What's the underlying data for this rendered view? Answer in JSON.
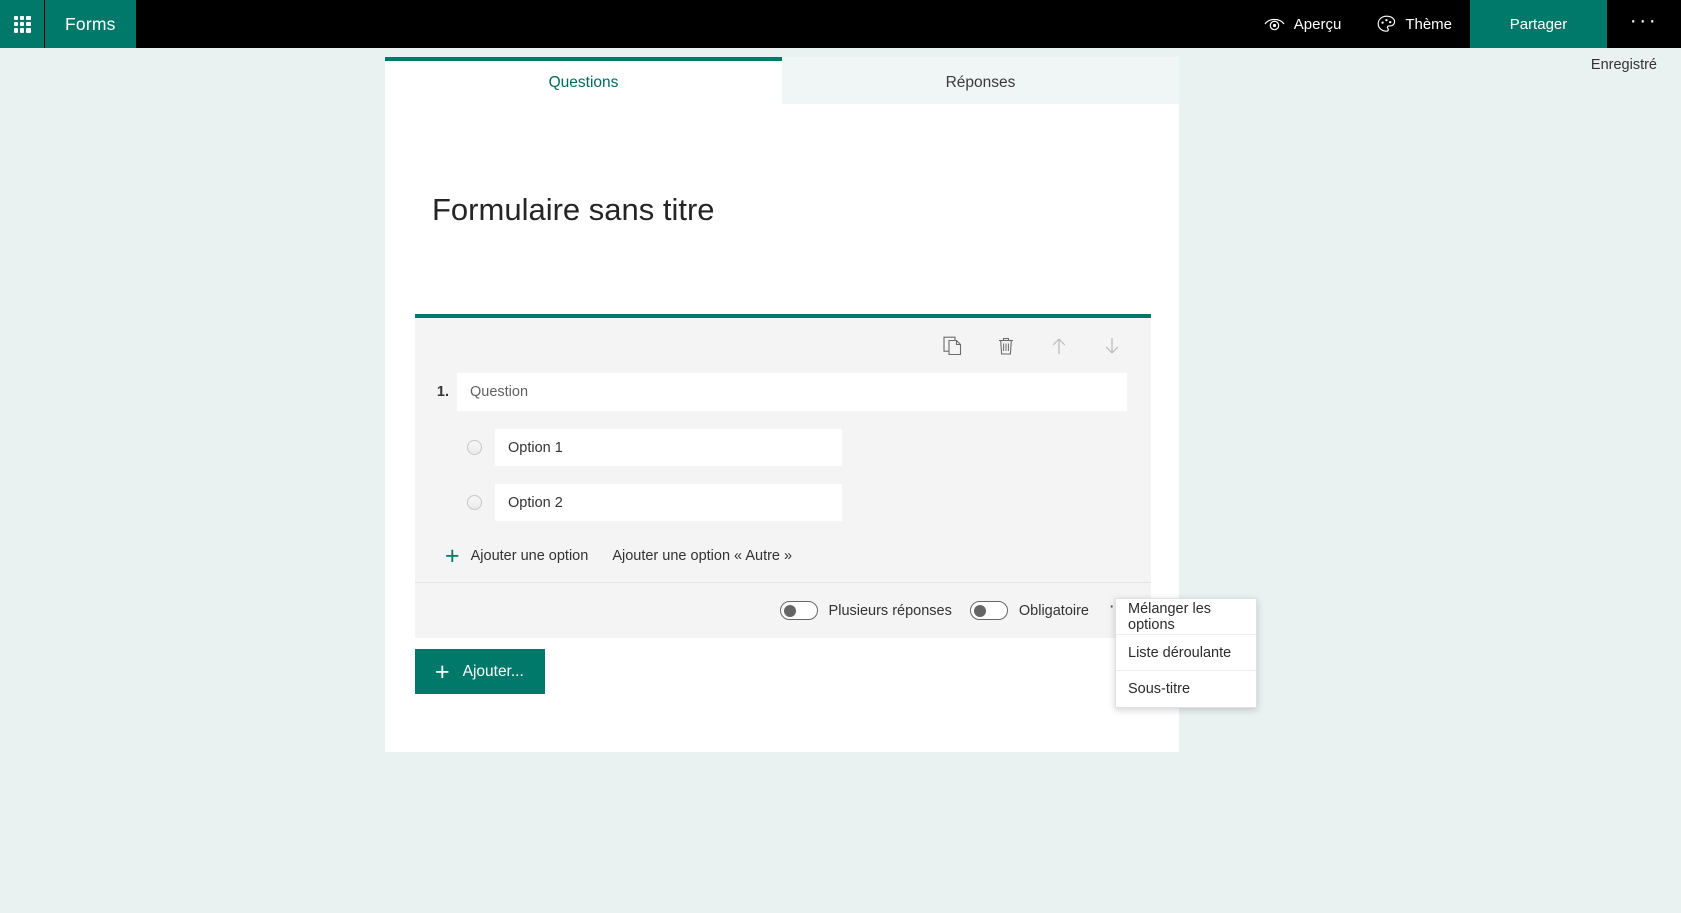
{
  "header": {
    "waffle_icon": "app-launcher-waffle-icon",
    "brand": "Forms",
    "preview": {
      "label": "Aperçu",
      "icon": "eye-preview-icon"
    },
    "theme": {
      "label": "Thème",
      "icon": "palette-theme-icon"
    },
    "share_label": "Partager",
    "more_label": "···",
    "accent_color": "#00796b",
    "bar_color": "#000000"
  },
  "status": {
    "saved_label": "Enregistré"
  },
  "tabs": [
    {
      "label": "Questions",
      "active": true
    },
    {
      "label": "Réponses",
      "active": false
    }
  ],
  "form": {
    "title": "Formulaire sans titre",
    "question": {
      "number": "1.",
      "text": "Question",
      "toolbar": [
        {
          "name": "copy-question-icon"
        },
        {
          "name": "delete-question-icon"
        },
        {
          "name": "move-up-icon"
        },
        {
          "name": "move-down-icon"
        }
      ],
      "options": [
        {
          "label": "Option 1"
        },
        {
          "label": "Option 2"
        }
      ],
      "add_option_label": "Ajouter une option",
      "add_other_option_label": "Ajouter une option « Autre »",
      "toggles": [
        {
          "label": "Plusieurs réponses",
          "on": false
        },
        {
          "label": "Obligatoire",
          "on": false
        }
      ],
      "more_label": "···"
    },
    "add_button_label": "Ajouter..."
  },
  "context_menu": {
    "items": [
      {
        "label": "Mélanger les options"
      },
      {
        "label": "Liste déroulante"
      },
      {
        "label": "Sous-titre"
      }
    ]
  }
}
